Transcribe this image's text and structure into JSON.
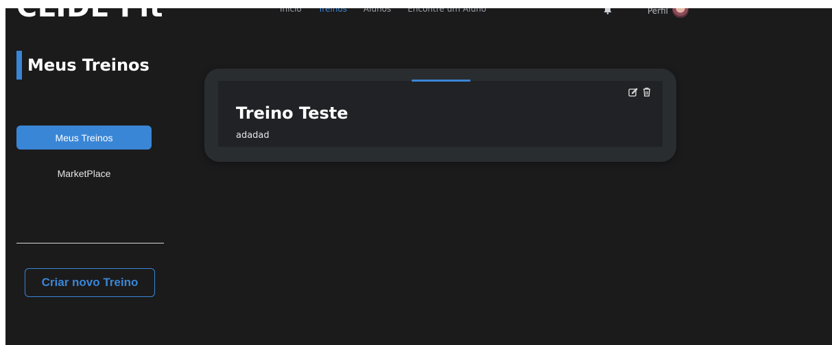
{
  "brand": "CLIDE Fit",
  "nav": {
    "items": [
      "Início",
      "Treinos",
      "Alunos",
      "Encontre um Aluno"
    ],
    "active_index": 1
  },
  "profile": {
    "label": "Perfil"
  },
  "sidebar": {
    "title": "Meus Treinos",
    "items": [
      {
        "label": "Meus Treinos",
        "active": true
      },
      {
        "label": "MarketPlace",
        "active": false
      }
    ],
    "create_button": "Criar novo Treino"
  },
  "workouts": [
    {
      "title": "Treino Teste",
      "description": "adadad"
    }
  ],
  "colors": {
    "accent": "#3a86d6",
    "background": "#1b1b1c",
    "card_outer": "#2a2d30",
    "card_inner": "#202225"
  },
  "icons": {
    "edit": "edit-icon",
    "delete": "trash-icon",
    "notifications": "bell-icon"
  }
}
